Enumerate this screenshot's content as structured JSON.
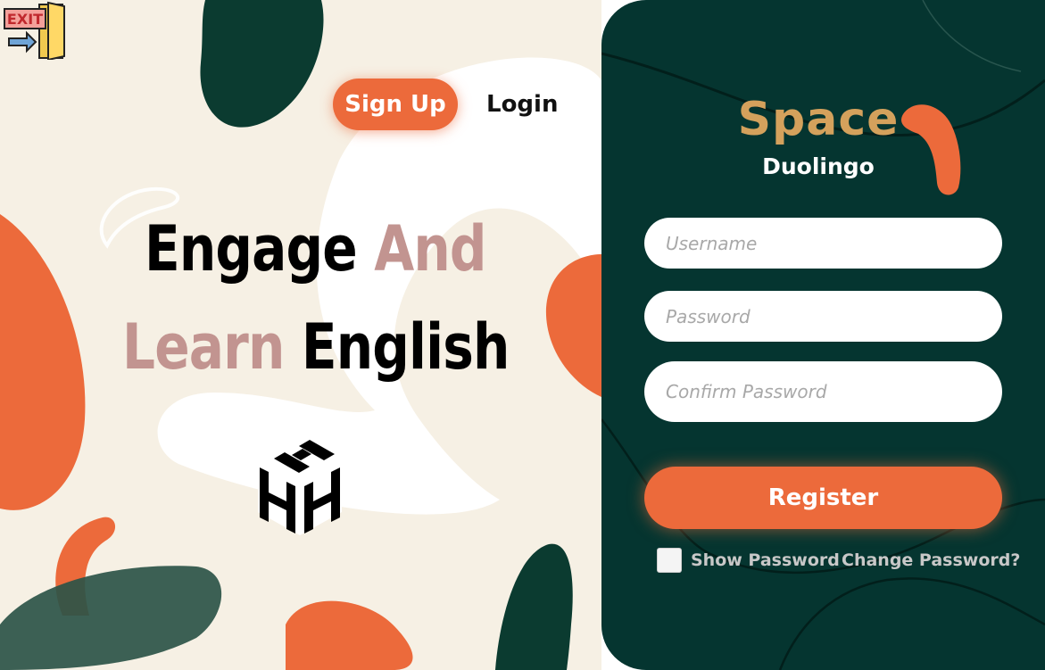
{
  "exit_button": {
    "label": "EXIT",
    "icon": "exit-door-icon"
  },
  "nav": {
    "signup_label": "Sign Up",
    "login_label": "Login"
  },
  "headline": {
    "line1_word1": "Engage",
    "line1_word2": "And",
    "line2_word1": "Learn",
    "line2_word2": "English"
  },
  "logo": {
    "icon": "hhh-cube-logo"
  },
  "brand": {
    "title": "Space",
    "subtitle": "Duolingo"
  },
  "form": {
    "username_placeholder": "Username",
    "password_placeholder": "Password",
    "confirm_placeholder": "Confirm Password",
    "register_label": "Register",
    "show_password_label": "Show Password",
    "change_password_label": "Change Password?"
  },
  "colors": {
    "accent": "#ec6a3b",
    "panel": "#053530",
    "cream": "#f6f0e4",
    "brand_gold": "#d4a15c",
    "headline_pink": "#c29490"
  }
}
